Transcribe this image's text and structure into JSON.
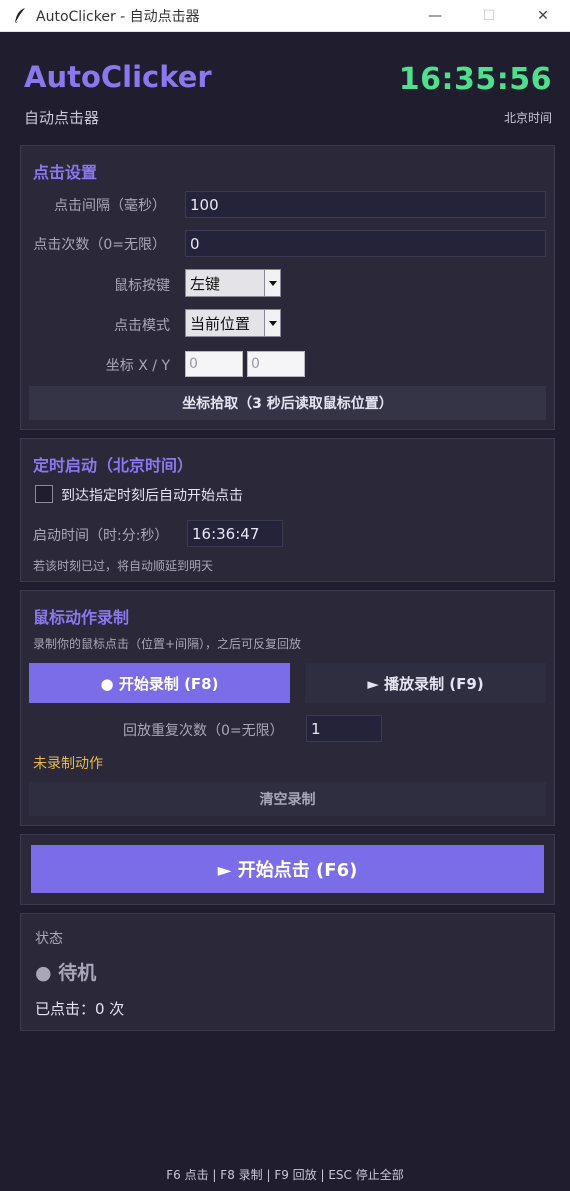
{
  "window": {
    "title": "AutoClicker - 自动点击器",
    "minimize": "—",
    "maximize": "☐",
    "close": "✕"
  },
  "header": {
    "app_name": "AutoClicker",
    "subtitle": "自动点击器",
    "clock": "16:35:56",
    "clock_label": "北京时间"
  },
  "click_settings": {
    "title": "点击设置",
    "interval_label": "点击间隔（毫秒）",
    "interval_value": "100",
    "count_label": "点击次数（0=无限）",
    "count_value": "0",
    "button_label": "鼠标按键",
    "button_value": "左键",
    "mode_label": "点击模式",
    "mode_value": "当前位置",
    "coord_label": "坐标 X / Y",
    "coord_x": "0",
    "coord_y": "0",
    "pick_button": "坐标拾取（3 秒后读取鼠标位置）"
  },
  "schedule": {
    "title": "定时启动（北京时间）",
    "checkbox_label": "到达指定时刻后自动开始点击",
    "time_label": "启动时间（时:分:秒）",
    "time_value": "16:36:47",
    "note": "若该时刻已过，将自动顺延到明天"
  },
  "recording": {
    "title": "鼠标动作录制",
    "description": "录制你的鼠标点击（位置+间隔），之后可反复回放",
    "record_button": "●  开始录制 (F8)",
    "play_button": "►  播放录制 (F9)",
    "repeat_label": "回放重复次数（0=无限）",
    "repeat_value": "1",
    "status": "未录制动作",
    "clear_button": "清空录制"
  },
  "start": {
    "button": "►  开始点击 (F6)"
  },
  "status": {
    "label": "状态",
    "state": "● 待机",
    "clicked": "已点击：0 次"
  },
  "footer": "F6 点击 | F8 录制 | F9 回放 | ESC 停止全部",
  "colors": {
    "background": "#1f1d2e",
    "panel": "#2a2839",
    "accent": "#7b6ce8",
    "clock": "#4ee08c",
    "warning": "#e8b84a"
  }
}
